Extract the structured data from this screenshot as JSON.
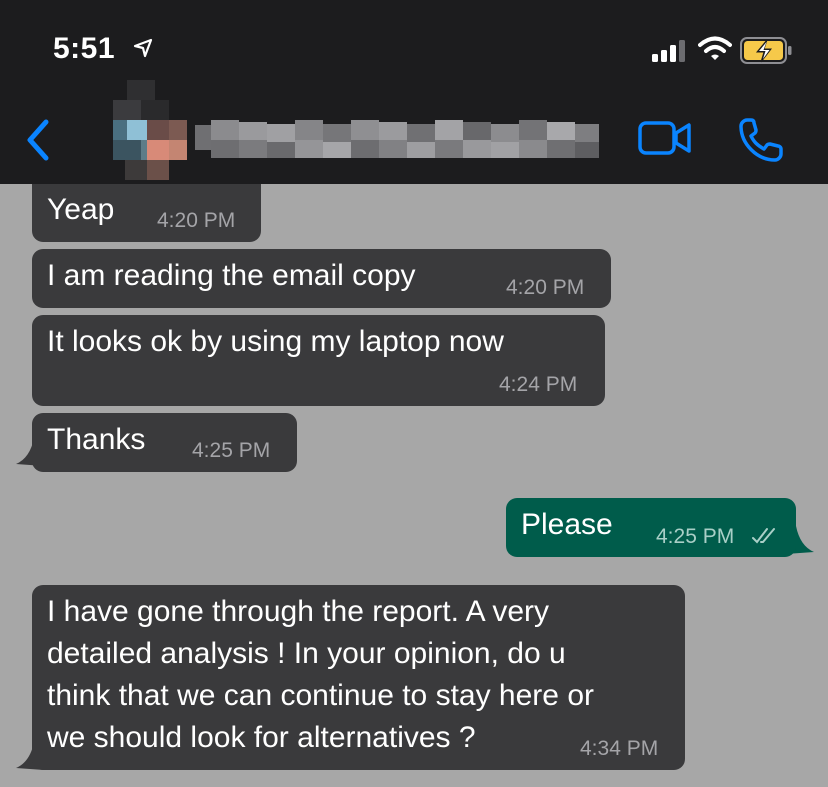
{
  "status_bar": {
    "time": "5:51",
    "icons": [
      "location-arrow-icon",
      "cellular-signal-icon",
      "wifi-icon",
      "battery-charging-icon"
    ]
  },
  "header": {
    "back_icon": "chevron-left-icon",
    "contact_name_state": "pixelated",
    "actions": [
      "video-call-icon",
      "phone-call-icon"
    ],
    "accent_color": "#0a84ff"
  },
  "messages": [
    {
      "direction": "incoming",
      "text": "Yeap",
      "time": "4:20 PM"
    },
    {
      "direction": "incoming",
      "text": "I am reading the email copy",
      "time": "4:20 PM"
    },
    {
      "direction": "incoming",
      "text": "It looks ok by using my laptop now",
      "time": "4:24 PM"
    },
    {
      "direction": "incoming",
      "text": "Thanks",
      "time": "4:25 PM"
    },
    {
      "direction": "outgoing",
      "text": "Please",
      "time": "4:25 PM",
      "status": "read"
    },
    {
      "direction": "incoming",
      "lines": [
        "I have gone through the report. A very",
        "detailed analysis ! In your opinion, do u",
        "think that we can continue to stay here or",
        "we should look for alternatives ?"
      ],
      "time": "4:34 PM"
    }
  ],
  "colors": {
    "chat_background": "#a7a7a7",
    "incoming_bubble": "#3a3a3c",
    "outgoing_bubble": "#005c4b",
    "header_background": "#1c1c1e"
  }
}
